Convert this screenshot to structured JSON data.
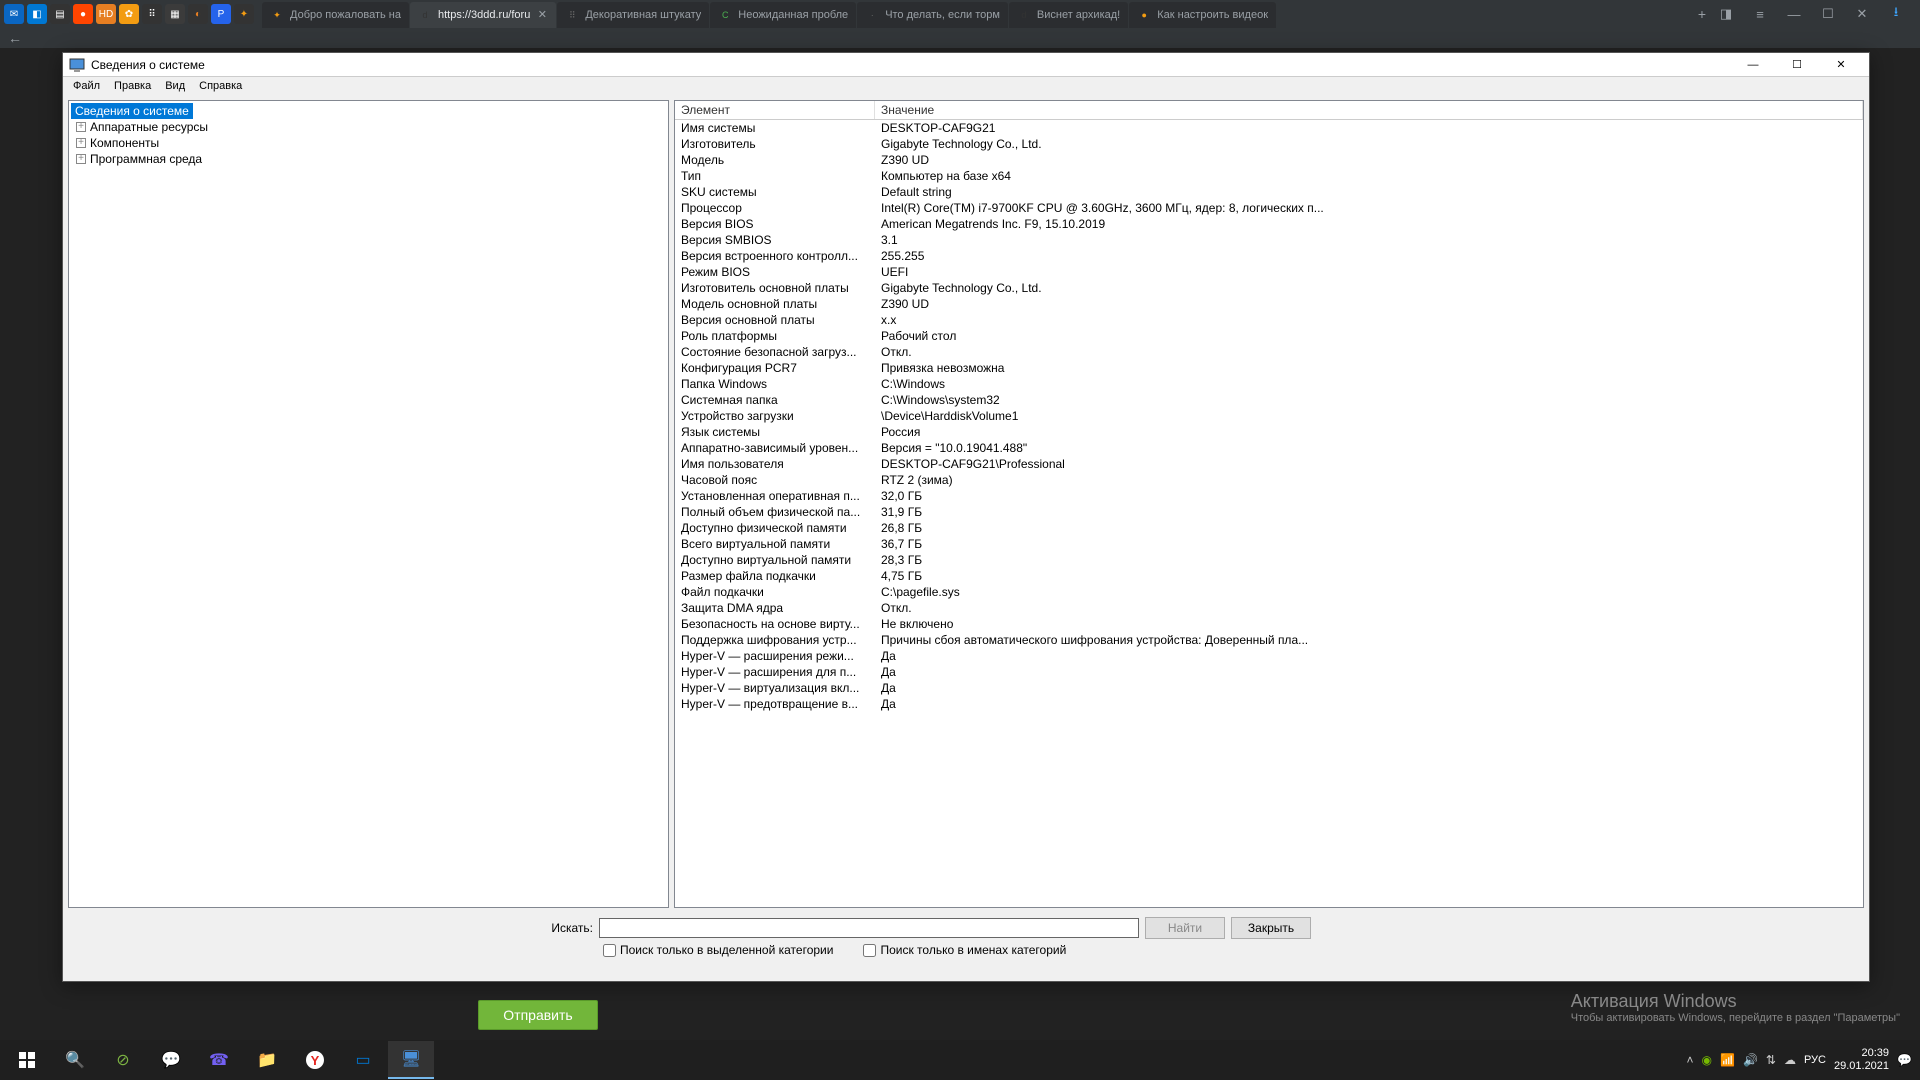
{
  "browser": {
    "tabs": [
      {
        "title": "Добро пожаловать на"
      },
      {
        "title": "https://3ddd.ru/foru",
        "active": true
      },
      {
        "title": "Декоративная штукату"
      },
      {
        "title": "Неожиданная пробле"
      },
      {
        "title": "Что делать, если торм"
      },
      {
        "title": "Виснет архикад!"
      },
      {
        "title": "Как настроить видеок"
      }
    ]
  },
  "window": {
    "title": "Сведения о системе",
    "menu": [
      "Файл",
      "Правка",
      "Вид",
      "Справка"
    ],
    "tree": {
      "root": "Сведения о системе",
      "children": [
        "Аппаратные ресурсы",
        "Компоненты",
        "Программная среда"
      ]
    },
    "headers": {
      "element": "Элемент",
      "value": "Значение"
    },
    "rows": [
      {
        "k": "Имя системы",
        "v": "DESKTOP-CAF9G21"
      },
      {
        "k": "Изготовитель",
        "v": "Gigabyte Technology Co., Ltd."
      },
      {
        "k": "Модель",
        "v": "Z390 UD"
      },
      {
        "k": "Тип",
        "v": "Компьютер на базе x64"
      },
      {
        "k": "SKU системы",
        "v": "Default string"
      },
      {
        "k": "Процессор",
        "v": "Intel(R) Core(TM) i7-9700KF CPU @ 3.60GHz, 3600 МГц, ядер: 8, логических п..."
      },
      {
        "k": "Версия BIOS",
        "v": "American Megatrends Inc. F9, 15.10.2019"
      },
      {
        "k": "Версия SMBIOS",
        "v": "3.1"
      },
      {
        "k": "Версия встроенного контролл...",
        "v": "255.255"
      },
      {
        "k": "Режим BIOS",
        "v": "UEFI"
      },
      {
        "k": "Изготовитель основной платы",
        "v": "Gigabyte Technology Co., Ltd."
      },
      {
        "k": "Модель основной платы",
        "v": "Z390 UD"
      },
      {
        "k": "Версия основной платы",
        "v": "x.x"
      },
      {
        "k": "Роль платформы",
        "v": "Рабочий стол"
      },
      {
        "k": "Состояние безопасной загруз...",
        "v": "Откл."
      },
      {
        "k": "Конфигурация PCR7",
        "v": "Привязка невозможна"
      },
      {
        "k": "Папка Windows",
        "v": "C:\\Windows"
      },
      {
        "k": "Системная папка",
        "v": "C:\\Windows\\system32"
      },
      {
        "k": "Устройство загрузки",
        "v": "\\Device\\HarddiskVolume1"
      },
      {
        "k": "Язык системы",
        "v": "Россия"
      },
      {
        "k": "Аппаратно-зависимый уровен...",
        "v": "Версия = \"10.0.19041.488\""
      },
      {
        "k": "Имя пользователя",
        "v": "DESKTOP-CAF9G21\\Professional"
      },
      {
        "k": "Часовой пояс",
        "v": "RTZ 2 (зима)"
      },
      {
        "k": "Установленная оперативная п...",
        "v": "32,0 ГБ"
      },
      {
        "k": "Полный объем физической па...",
        "v": "31,9 ГБ"
      },
      {
        "k": "Доступно физической памяти",
        "v": "26,8 ГБ"
      },
      {
        "k": "Всего виртуальной памяти",
        "v": "36,7 ГБ"
      },
      {
        "k": "Доступно виртуальной памяти",
        "v": "28,3 ГБ"
      },
      {
        "k": "Размер файла подкачки",
        "v": "4,75 ГБ"
      },
      {
        "k": "Файл подкачки",
        "v": "C:\\pagefile.sys"
      },
      {
        "k": "Защита DMA ядра",
        "v": "Откл."
      },
      {
        "k": "Безопасность на основе вирту...",
        "v": "Не включено"
      },
      {
        "k": "Поддержка шифрования устр...",
        "v": "Причины сбоя автоматического шифрования устройства: Доверенный пла..."
      },
      {
        "k": "Hyper-V — расширения режи...",
        "v": "Да"
      },
      {
        "k": "Hyper-V — расширения для п...",
        "v": "Да"
      },
      {
        "k": "Hyper-V — виртуализация вкл...",
        "v": "Да"
      },
      {
        "k": "Hyper-V — предотвращение в...",
        "v": "Да"
      }
    ],
    "search": {
      "label": "Искать:",
      "find": "Найти",
      "close": "Закрыть",
      "chk1": "Поиск только в выделенной категории",
      "chk2": "Поиск только в именах категорий"
    }
  },
  "page": {
    "send_btn": "Отправить"
  },
  "activation": {
    "line1": "Активация Windows",
    "line2": "Чтобы активировать Windows, перейдите в раздел \"Параметры\""
  },
  "taskbar": {
    "lang": "РУС",
    "time": "20:39",
    "date": "29.01.2021"
  }
}
